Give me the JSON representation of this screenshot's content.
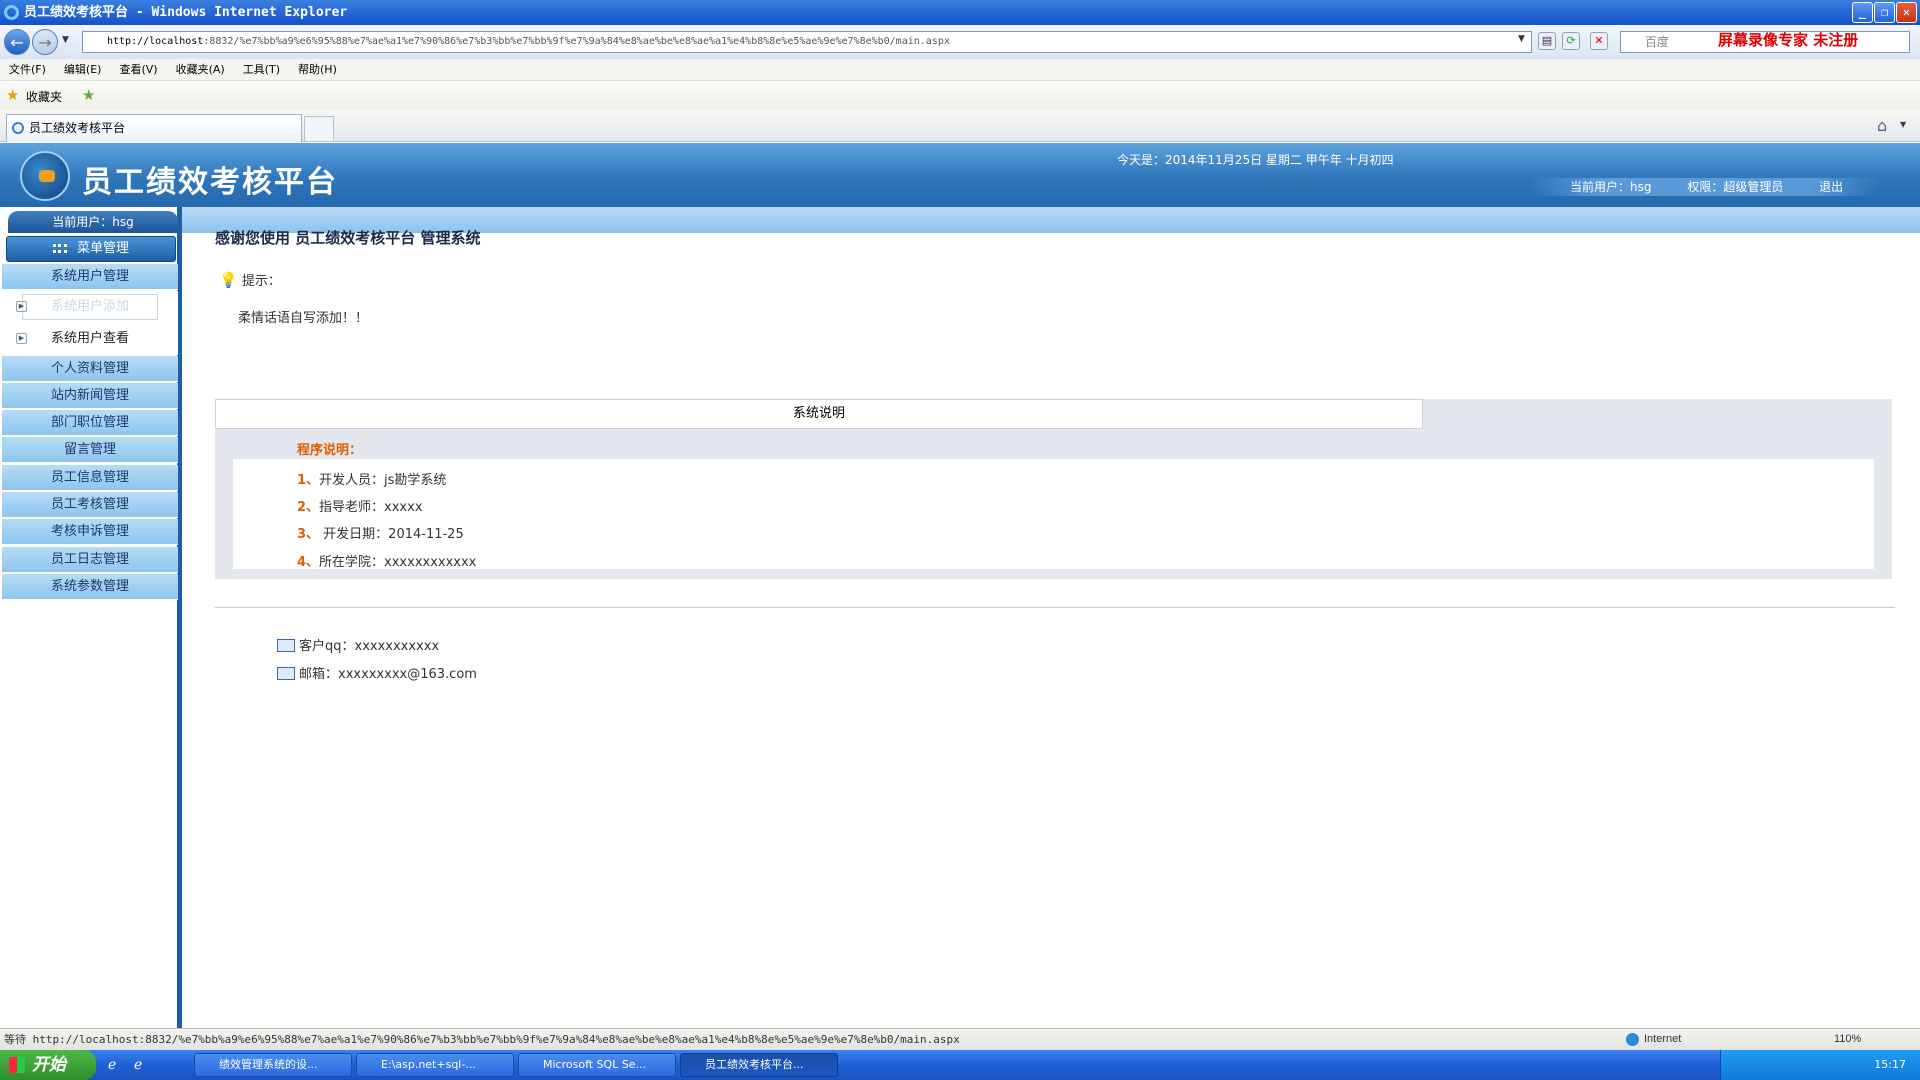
{
  "window": {
    "title": "员工绩效考核平台 - Windows Internet Explorer"
  },
  "address": {
    "url_host": "http://localhost",
    "url_rest": ":8832/%e7%bb%a9%e6%95%88%e7%ae%a1%e7%90%86%e7%b3%bb%e7%bb%9f%e7%9a%84%e8%ae%be%e8%ae%a1%e4%b8%8e%e5%ae%9e%e7%8e%b0/main.aspx",
    "search_placeholder": "百度",
    "recorder_text": "屏幕录像专家  未注册"
  },
  "menu": [
    "文件(F)",
    "编辑(E)",
    "查看(V)",
    "收藏夹(A)",
    "工具(T)",
    "帮助(H)"
  ],
  "favorites": {
    "label": "收藏夹"
  },
  "tab": {
    "title": "员工绩效考核平台"
  },
  "banner": {
    "title": "员工绩效考核平台",
    "date": "今天是：2014年11月25日  星期二  甲午年  十月初四",
    "current_user": "当前用户：hsg",
    "permission": "权限：超级管理员",
    "logout": "退出"
  },
  "sidebar": {
    "current_user": "当前用户：hsg",
    "menu_title": "菜单管理",
    "items": [
      "系统用户管理",
      "个人资料管理",
      "站内新闻管理",
      "部门职位管理",
      "留言管理",
      "员工信息管理",
      "员工考核管理",
      "考核申诉管理",
      "员工日志管理",
      "系统参数管理"
    ],
    "subitems": [
      "系统用户添加",
      "系统用户查看"
    ]
  },
  "content": {
    "welcome": "感谢您使用 员工绩效考核平台 管理系统",
    "tip_label": "提示：",
    "tip_message": "柔情话语自写添加！！",
    "sys_title": "系统说明",
    "prog_title": "程序说明：",
    "lines": [
      {
        "num": "1、",
        "text": "开发人员：js勘学系统"
      },
      {
        "num": "2、",
        "text": "指导老师：xxxxx"
      },
      {
        "num": "3、",
        "text": " 开发日期：2014-11-25"
      },
      {
        "num": "4、",
        "text": "所在学院：xxxxxxxxxxxx"
      }
    ],
    "qq": "客户qq：xxxxxxxxxxx",
    "email": "邮箱：xxxxxxxxx@163.com"
  },
  "status": {
    "text": "等待 http://localhost:8832/%e7%bb%a9%e6%95%88%e7%ae%a1%e7%90%86%e7%b3%bb%e7%bb%9f%e7%9a%84%e8%ae%be%e8%ae%a1%e4%b8%8e%e5%ae%9e%e7%8e%b0/main.aspx",
    "zone": "Internet",
    "zoom": "110%"
  },
  "taskbar": {
    "start": "开始",
    "tasks": [
      "绩效管理系统的设...",
      "E:\\asp.net+sql-...",
      "Microsoft SQL Se...",
      "员工绩效考核平台..."
    ],
    "clock": "15:17"
  }
}
